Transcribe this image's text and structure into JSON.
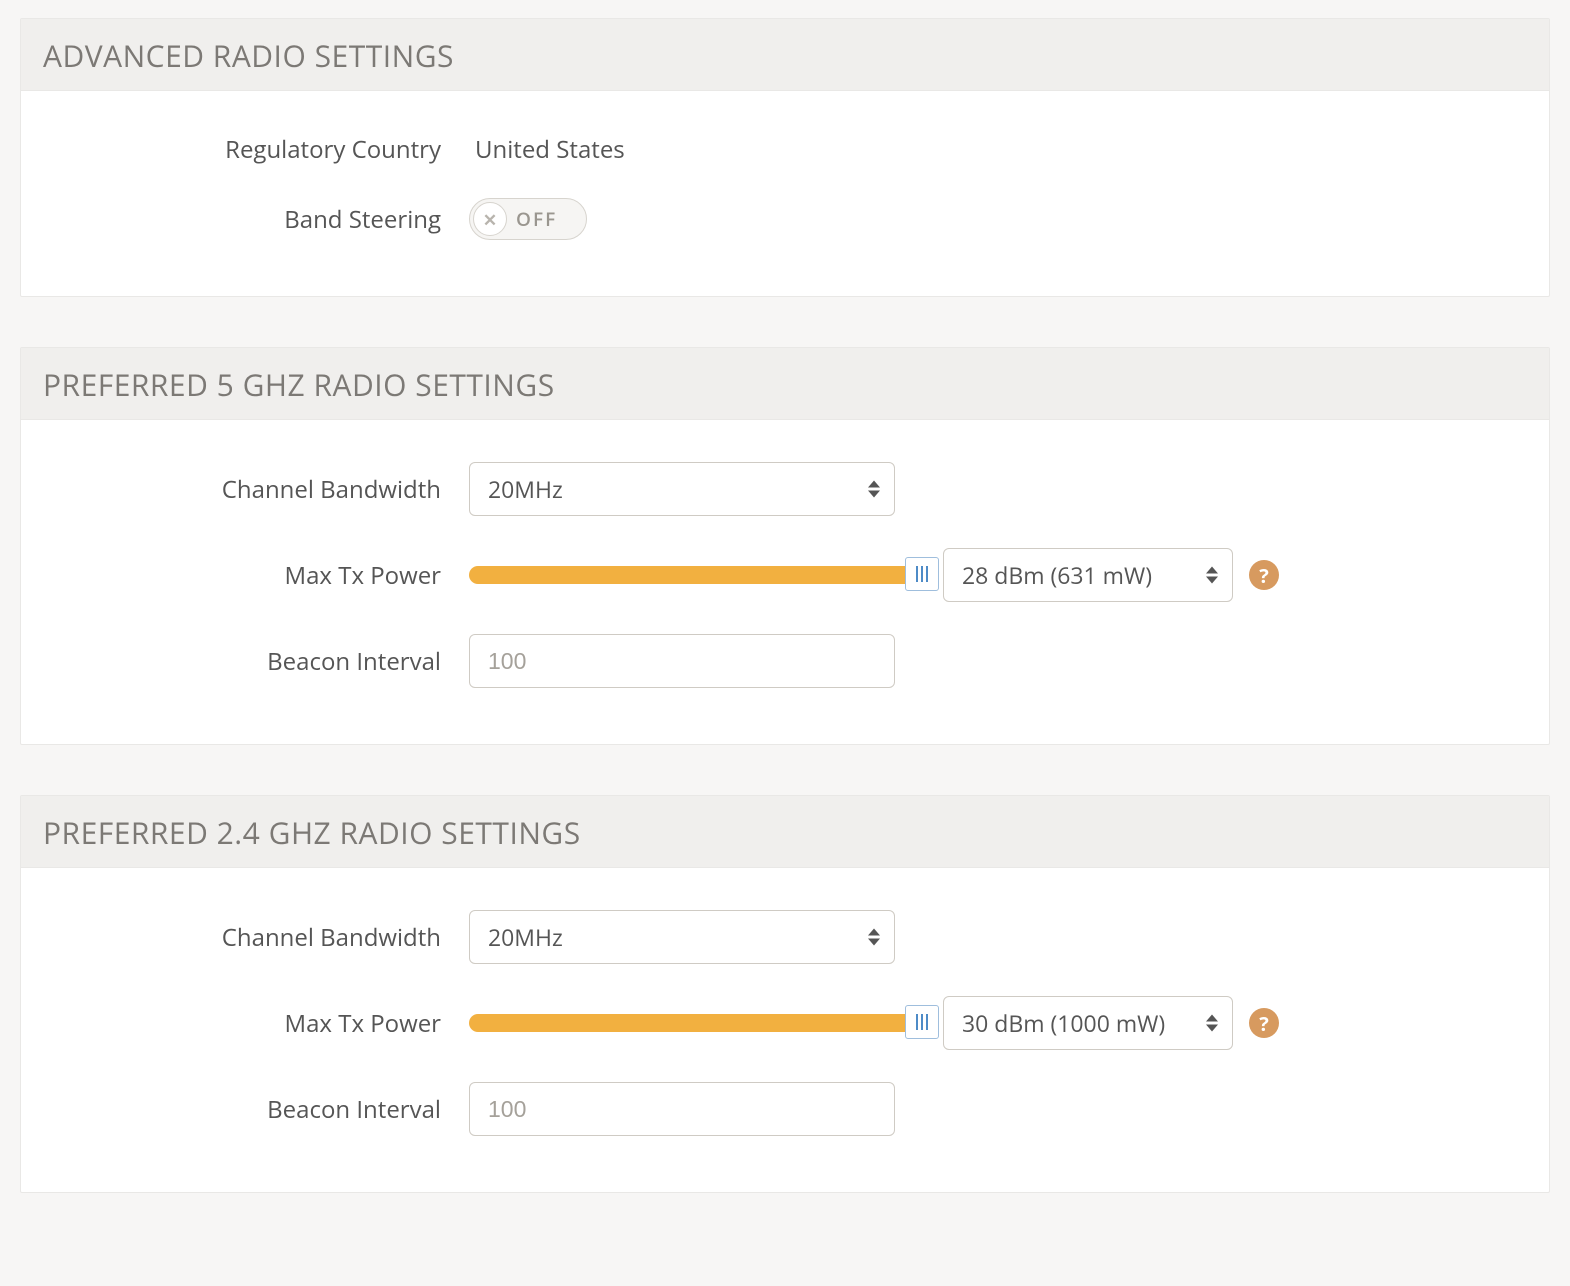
{
  "sections": {
    "advanced": {
      "title": "ADVANCED RADIO SETTINGS",
      "country_label": "Regulatory Country",
      "country_value": "United States",
      "band_steering_label": "Band Steering",
      "band_steering_state": "OFF"
    },
    "ghz5": {
      "title": "PREFERRED 5 GHZ RADIO SETTINGS",
      "bandwidth_label": "Channel Bandwidth",
      "bandwidth_value": "20MHz",
      "txpower_label": "Max Tx Power",
      "txpower_value": "28 dBm (631 mW)",
      "txpower_slider_percent": 100,
      "beacon_label": "Beacon Interval",
      "beacon_value": "100"
    },
    "ghz24": {
      "title": "PREFERRED 2.4 GHZ RADIO SETTINGS",
      "bandwidth_label": "Channel Bandwidth",
      "bandwidth_value": "20MHz",
      "txpower_label": "Max Tx Power",
      "txpower_value": "30 dBm (1000 mW)",
      "txpower_slider_percent": 100,
      "beacon_label": "Beacon Interval",
      "beacon_value": "100"
    }
  },
  "glyphs": {
    "help": "?"
  }
}
